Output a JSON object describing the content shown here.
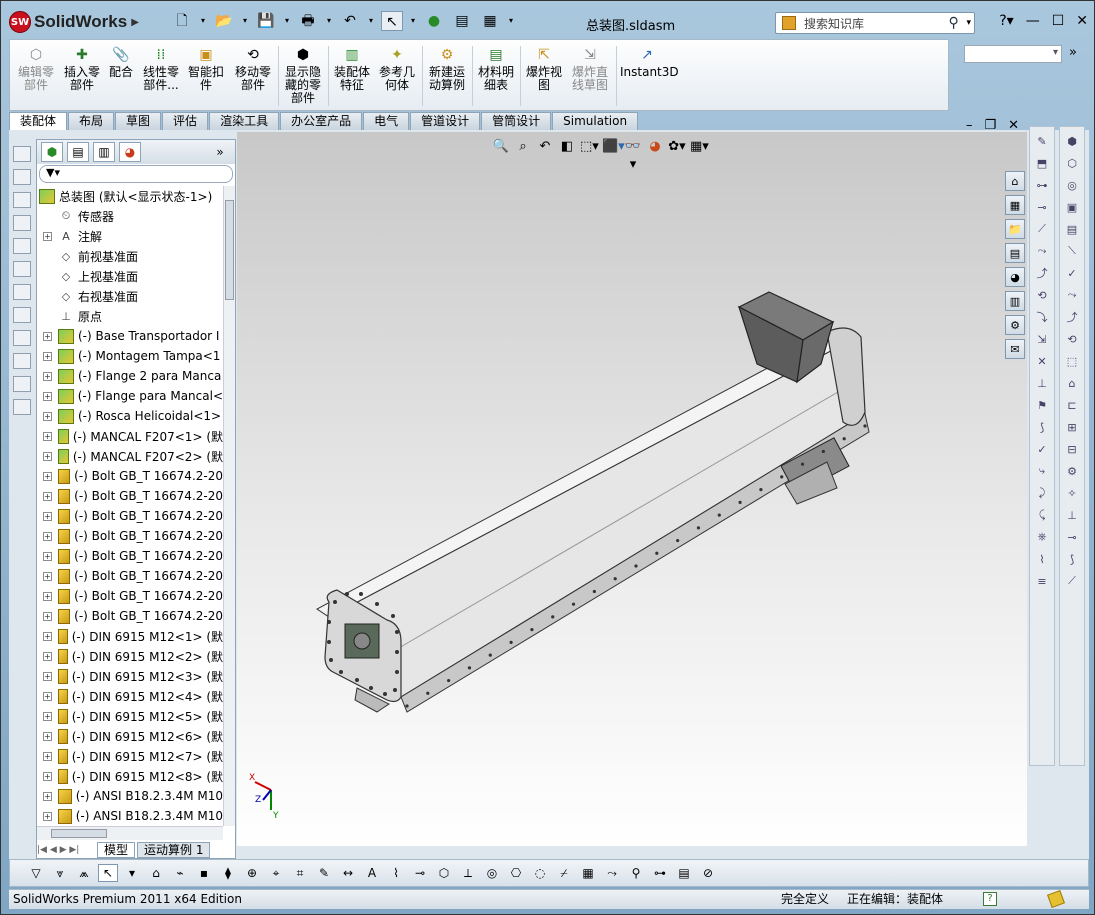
{
  "app": {
    "logo_badge": "SW",
    "brand": "SolidWorks",
    "doc_title": "总装图.sldasm"
  },
  "search": {
    "placeholder": "搜索知识库"
  },
  "ribbon": {
    "buttons": [
      {
        "label": "编辑零部件",
        "icon": "edit-component-icon",
        "disabled": true
      },
      {
        "label": "插入零部件",
        "icon": "insert-component-icon"
      },
      {
        "label": "配合",
        "icon": "mate-icon"
      },
      {
        "label": "线性零部件...",
        "icon": "linear-pattern-icon"
      },
      {
        "label": "智能扣件",
        "icon": "smart-fasteners-icon"
      },
      {
        "label": "移动零部件",
        "icon": "move-component-icon"
      },
      {
        "label": "显示隐藏的零部件",
        "icon": "show-hidden-icon"
      },
      {
        "label": "装配体特征",
        "icon": "assembly-features-icon"
      },
      {
        "label": "参考几何体",
        "icon": "reference-geometry-icon"
      },
      {
        "label": "新建运动算例",
        "icon": "motion-study-icon"
      },
      {
        "label": "材料明细表",
        "icon": "bom-icon"
      },
      {
        "label": "爆炸视图",
        "icon": "exploded-view-icon"
      },
      {
        "label": "爆炸直线草图",
        "icon": "explode-line-sketch-icon",
        "disabled": true
      },
      {
        "label": "Instant3D",
        "icon": "instant3d-icon"
      }
    ]
  },
  "tabs": [
    "装配体",
    "布局",
    "草图",
    "评估",
    "渲染工具",
    "办公室产品",
    "电气",
    "管道设计",
    "管筒设计",
    "Simulation"
  ],
  "tree": {
    "root": "总装图 (默认<显示状态-1>)",
    "items": [
      {
        "label": "传感器",
        "icon": "sensor-icon",
        "expand": false
      },
      {
        "label": "注解",
        "icon": "annotation-icon",
        "expand": true
      },
      {
        "label": "前视基准面",
        "icon": "plane-icon",
        "expand": false
      },
      {
        "label": "上视基准面",
        "icon": "plane-icon",
        "expand": false
      },
      {
        "label": "右视基准面",
        "icon": "plane-icon",
        "expand": false
      },
      {
        "label": "原点",
        "icon": "origin-icon",
        "expand": false
      },
      {
        "label": "(-) Base Transportador I",
        "icon": "subassembly-icon",
        "expand": true
      },
      {
        "label": "(-) Montagem Tampa<1",
        "icon": "subassembly-icon",
        "expand": true
      },
      {
        "label": "(-) Flange 2 para Manca",
        "icon": "subassembly-icon",
        "expand": true
      },
      {
        "label": "(-) Flange para Mancal<",
        "icon": "subassembly-icon",
        "expand": true
      },
      {
        "label": "(-) Rosca Helicoidal<1>",
        "icon": "subassembly-icon",
        "expand": true
      },
      {
        "label": "(-) MANCAL F207<1> (默",
        "icon": "subassembly-icon",
        "expand": true
      },
      {
        "label": "(-) MANCAL F207<2> (默",
        "icon": "subassembly-icon",
        "expand": true
      },
      {
        "label": "(-) Bolt GB_T 16674.2-20",
        "icon": "part-icon",
        "expand": true
      },
      {
        "label": "(-) Bolt GB_T 16674.2-20",
        "icon": "part-icon",
        "expand": true
      },
      {
        "label": "(-) Bolt GB_T 16674.2-20",
        "icon": "part-icon",
        "expand": true
      },
      {
        "label": "(-) Bolt GB_T 16674.2-20",
        "icon": "part-icon",
        "expand": true
      },
      {
        "label": "(-) Bolt GB_T 16674.2-20",
        "icon": "part-icon",
        "expand": true
      },
      {
        "label": "(-) Bolt GB_T 16674.2-20",
        "icon": "part-icon",
        "expand": true
      },
      {
        "label": "(-) Bolt GB_T 16674.2-20",
        "icon": "part-icon",
        "expand": true
      },
      {
        "label": "(-) Bolt GB_T 16674.2-20",
        "icon": "part-icon",
        "expand": true
      },
      {
        "label": "(-) DIN 6915 M12<1> (默",
        "icon": "part-icon",
        "expand": true
      },
      {
        "label": "(-) DIN 6915 M12<2> (默",
        "icon": "part-icon",
        "expand": true
      },
      {
        "label": "(-) DIN 6915 M12<3> (默",
        "icon": "part-icon",
        "expand": true
      },
      {
        "label": "(-) DIN 6915 M12<4> (默",
        "icon": "part-icon",
        "expand": true
      },
      {
        "label": "(-) DIN 6915 M12<5> (默",
        "icon": "part-icon",
        "expand": true
      },
      {
        "label": "(-) DIN 6915 M12<6> (默",
        "icon": "part-icon",
        "expand": true
      },
      {
        "label": "(-) DIN 6915 M12<7> (默",
        "icon": "part-icon",
        "expand": true
      },
      {
        "label": "(-) DIN 6915 M12<8> (默",
        "icon": "part-icon",
        "expand": true
      },
      {
        "label": "(-) ANSI B18.2.3.4M M10",
        "icon": "part-icon",
        "expand": true
      },
      {
        "label": "(-) ANSI B18.2.3.4M M10",
        "icon": "part-icon",
        "expand": true
      }
    ]
  },
  "bottom_tabs": [
    "模型",
    "运动算例 1"
  ],
  "triad": {
    "x": "X",
    "y": "Y",
    "z": "Z"
  },
  "status": {
    "edition": "SolidWorks Premium 2011 x64 Edition",
    "defined": "完全定义",
    "editing": "正在编辑：装配体"
  },
  "colors": {
    "accent": "#c8101e",
    "part": "#e2b52a",
    "assembly": "#7cd05a"
  }
}
